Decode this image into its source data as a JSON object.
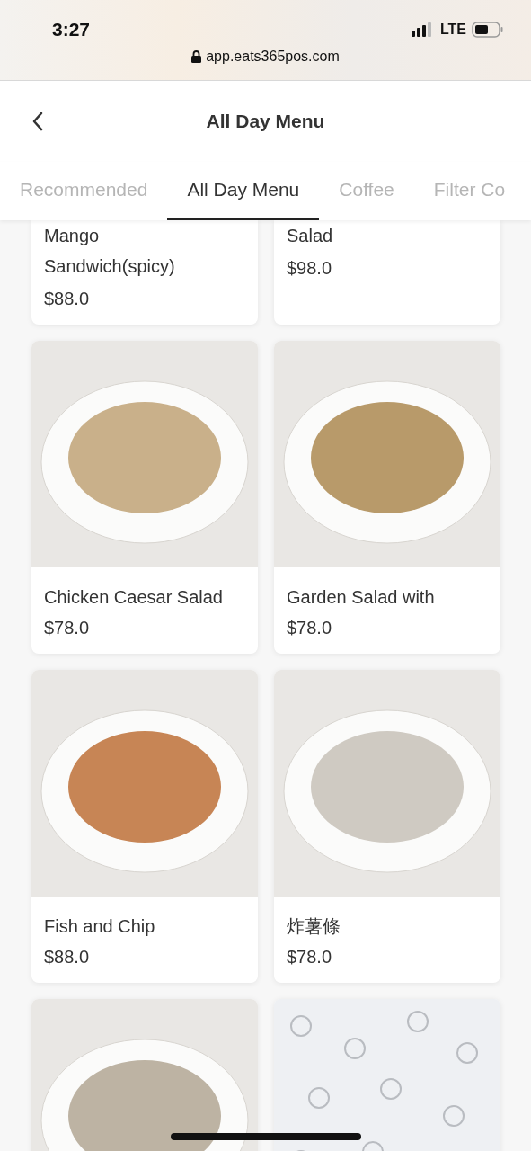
{
  "status_bar": {
    "time": "3:27",
    "network": "LTE"
  },
  "browser": {
    "url": "app.eats365pos.com"
  },
  "header": {
    "title": "All Day Menu"
  },
  "tabs": [
    {
      "label": "Recommended",
      "selected": false
    },
    {
      "label": "All Day Menu",
      "selected": true
    },
    {
      "label": "Coffee",
      "selected": false
    },
    {
      "label": "Filter Co",
      "selected": false
    }
  ],
  "items": [
    {
      "kind": "text",
      "name": "Mango\nSandwich(spicy)",
      "price": "$88.0"
    },
    {
      "kind": "text",
      "name": "Salad",
      "price": "$98.0"
    },
    {
      "kind": "full",
      "name": "Chicken Caesar Salad",
      "price": "$78.0"
    },
    {
      "kind": "full",
      "name": "Garden Salad with",
      "price": "$78.0"
    },
    {
      "kind": "full",
      "name": "Fish and Chip",
      "price": "$88.0"
    },
    {
      "kind": "full",
      "name": "炸薯條",
      "price": "$78.0"
    },
    {
      "kind": "photo"
    },
    {
      "kind": "pattern"
    }
  ]
}
